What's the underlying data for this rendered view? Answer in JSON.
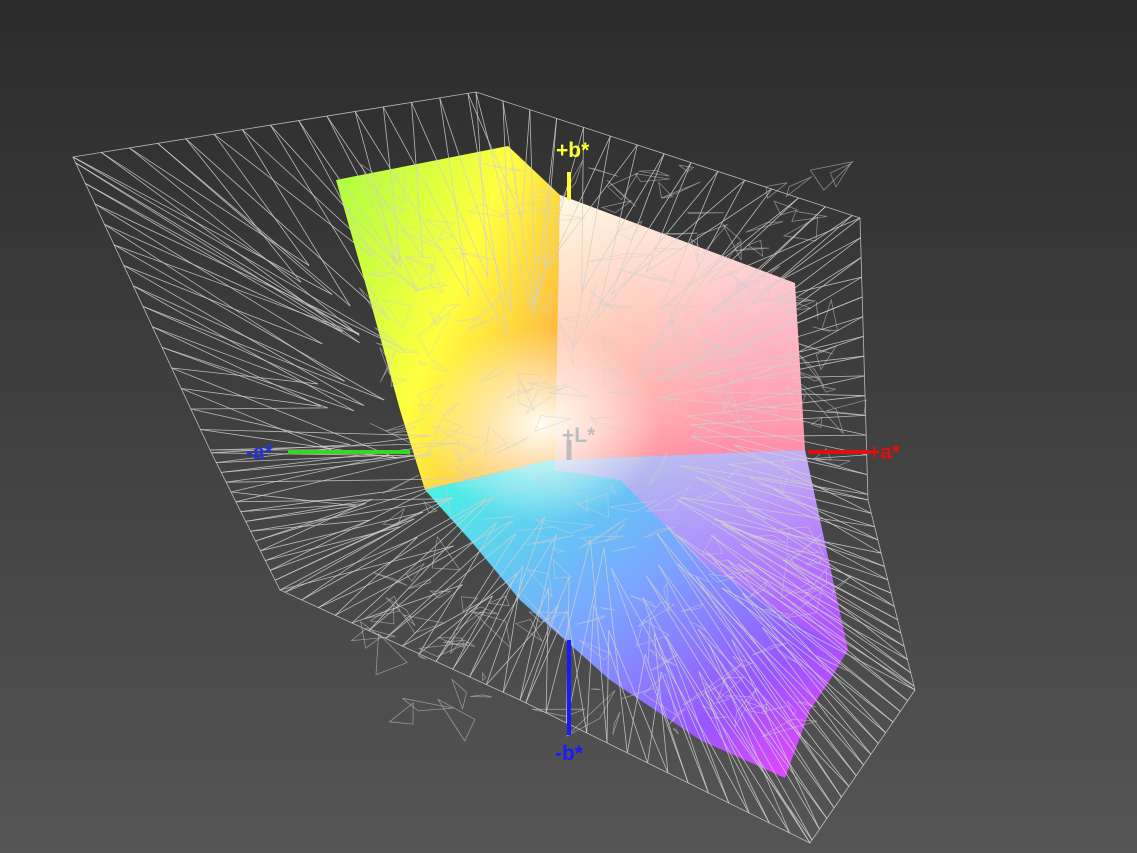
{
  "view": {
    "background_top": "#2b2b2b",
    "background_bottom": "#555555",
    "wireframe_color": "#d0d0d0"
  },
  "axes": {
    "plus_b": {
      "text": "+b*",
      "color": "#ffff33"
    },
    "minus_b": {
      "text": "-b*",
      "color": "#1a1aff"
    },
    "plus_a": {
      "text": "+a*",
      "color": "#e01010"
    },
    "minus_a": {
      "text": "-a*",
      "color": "#2233dd"
    },
    "plus_l": {
      "text": "+L*",
      "color": "#bdbdbd"
    }
  },
  "gamut_colors": {
    "yellow": "#ffff40",
    "green": "#a6ff3c",
    "red": "#ff5b5b",
    "orange": "#ff9a40",
    "magenta": "#ff40ff",
    "violet": "#9955ff",
    "cyan": "#40ffe0",
    "blue": "#7aa6ff",
    "white": "#fffdf2"
  }
}
